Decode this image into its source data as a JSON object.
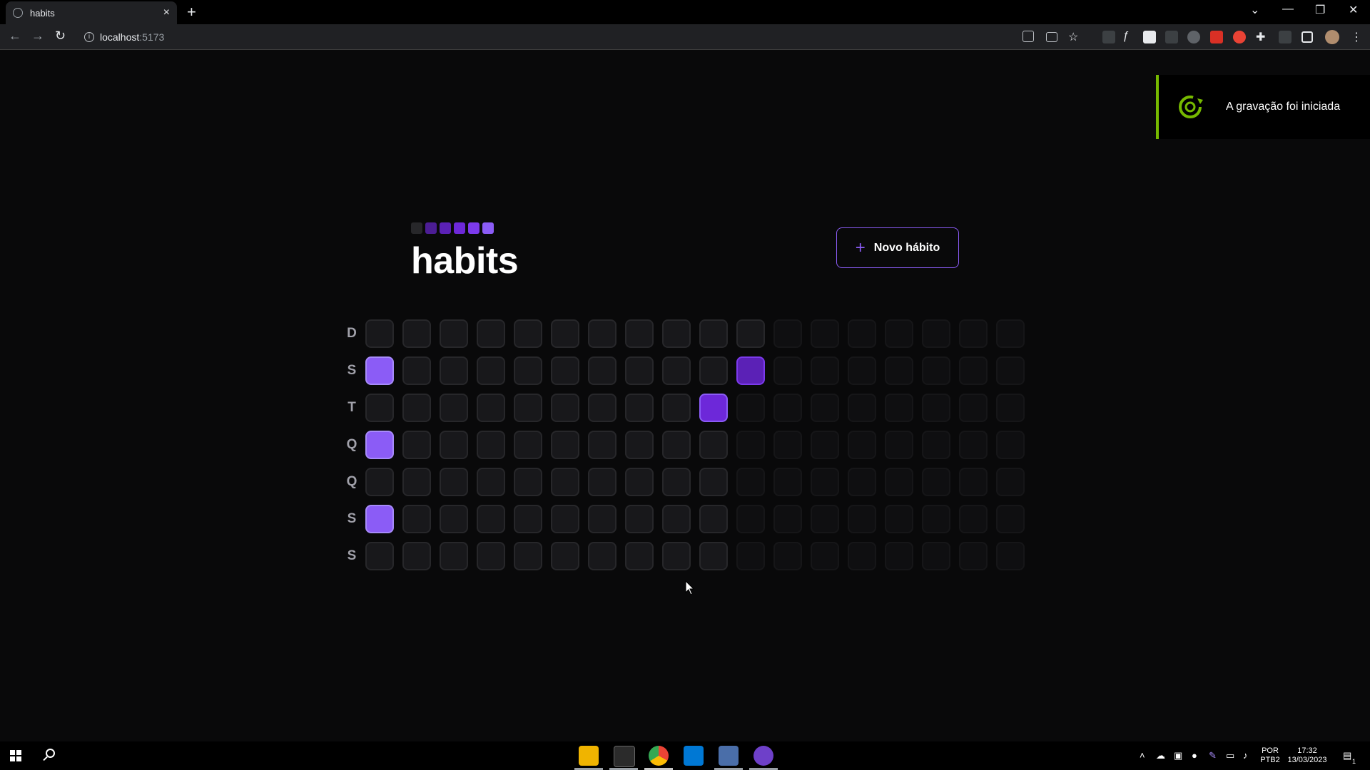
{
  "browser": {
    "tab_title": "habits",
    "tab_close": "×",
    "new_tab": "+",
    "url_host": "localhost",
    "url_port": ":5173",
    "win_chevron": "⌄",
    "win_min": "—",
    "win_restore": "❐",
    "win_close": "✕",
    "back": "←",
    "forward": "→",
    "reload": "↻",
    "info": "i",
    "menu": "⋮"
  },
  "app": {
    "title": "habits",
    "new_habit_label": "Novo hábito",
    "plus": "+",
    "logo_colors": [
      "#27272a",
      "#4c1d95",
      "#5b21b6",
      "#6d28d9",
      "#7c3aed",
      "#8b5cf6"
    ],
    "weekdays": [
      "D",
      "S",
      "T",
      "Q",
      "Q",
      "S",
      "S"
    ],
    "columns": 18,
    "active_columns": 11,
    "completed_days": [
      {
        "week": 0,
        "day": 1,
        "level": "high"
      },
      {
        "week": 0,
        "day": 3,
        "level": "high"
      },
      {
        "week": 0,
        "day": 5,
        "level": "high"
      },
      {
        "week": 9,
        "day": 2,
        "level": "mid"
      },
      {
        "week": 10,
        "day": 1,
        "level": "low"
      }
    ]
  },
  "toast": {
    "message": "A gravação foi iniciada",
    "accent": "#76b900"
  },
  "taskbar": {
    "lang_line1": "POR",
    "lang_line2": "PTB2",
    "time": "17:32",
    "date": "13/03/2023",
    "notification_count": "1"
  }
}
